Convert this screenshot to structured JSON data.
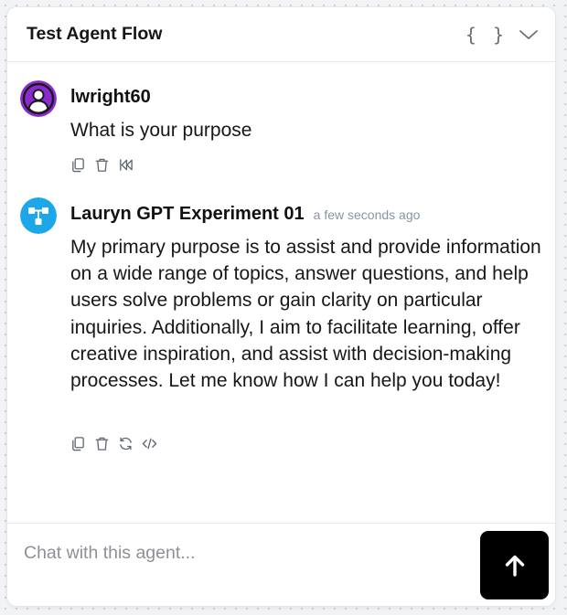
{
  "header": {
    "title": "Test Agent Flow",
    "code_toggle_label": "{ }"
  },
  "messages": [
    {
      "sender": "lwright60",
      "text": "What is your purpose",
      "avatar_color": "#8a2bd0",
      "actions": [
        "copy-icon",
        "trash-icon",
        "rewind-icon"
      ]
    },
    {
      "sender": "Lauryn GPT Experiment 01",
      "timestamp": "a few seconds ago",
      "text": "My primary purpose is to assist and provide information on a wide range of topics, answer questions, and help users solve problems or gain clarity on particular inquiries. Additionally, I aim to facilitate learning, offer creative inspiration, and assist with decision-making processes. Let me know how I can help you today!",
      "avatar_color": "#1ea7e8",
      "actions": [
        "copy-icon",
        "trash-icon",
        "refresh-icon",
        "code-icon"
      ]
    }
  ],
  "composer": {
    "placeholder": "Chat with this agent...",
    "value": ""
  },
  "colors": {
    "send_button": "#000000",
    "timestamp": "#8a93a3"
  }
}
